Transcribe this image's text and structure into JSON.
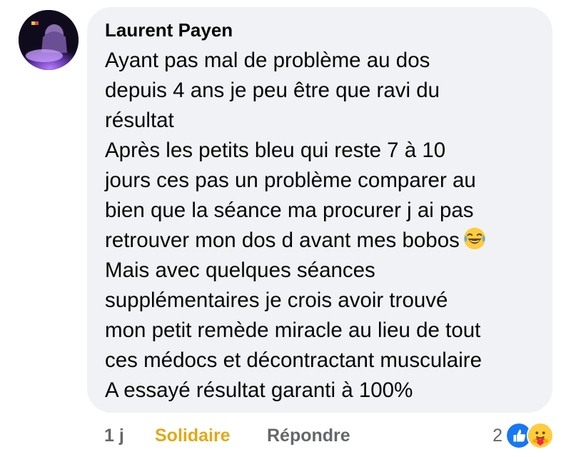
{
  "comment": {
    "author": "Laurent Payen",
    "lines": [
      "Ayant pas mal de problème au dos",
      "depuis 4 ans je peu être que ravi du",
      "résultat",
      "Après les petits bleu qui reste 7 à 10",
      "jours ces pas un problème comparer au",
      "bien que la séance ma procurer j ai pas",
      "retrouver mon dos d avant mes bobos",
      "Mais avec quelques séances",
      "supplémentaires je crois avoir trouvé",
      "mon petit remède miracle au lieu de tout",
      "ces médocs et décontractant musculaire",
      "A essayé résultat garanti à 100%"
    ],
    "inline_emoji": "laughing-tears-emoji"
  },
  "actions": {
    "time": "1 j",
    "reaction_label": "Solidaire",
    "reply_label": "Répondre"
  },
  "reactions": {
    "count": "2",
    "icons": [
      "like-icon",
      "care-icon"
    ]
  },
  "colors": {
    "bubble": "#f0f2f5",
    "text": "#050505",
    "secondary": "#65676b",
    "care_reaction": "#e2a817",
    "like_blue": "#1877f2"
  }
}
